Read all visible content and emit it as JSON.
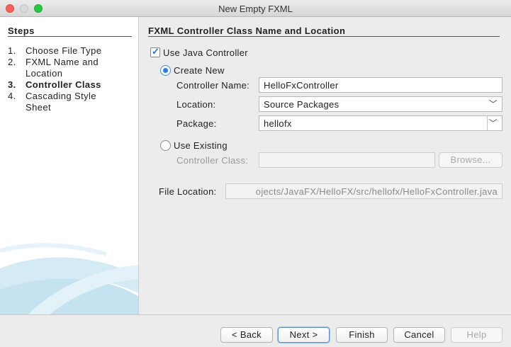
{
  "window": {
    "title": "New Empty FXML"
  },
  "steps": {
    "title": "Steps",
    "items": [
      {
        "num": "1.",
        "label": "Choose File Type"
      },
      {
        "num": "2.",
        "label": "FXML Name and Location"
      },
      {
        "num": "3.",
        "label": "Controller Class"
      },
      {
        "num": "4.",
        "label": "Cascading Style Sheet"
      }
    ],
    "active_index": 2
  },
  "panel": {
    "title": "FXML Controller Class Name and Location",
    "use_java_controller": {
      "label": "Use Java Controller",
      "checked": true
    },
    "create_new": {
      "label": "Create New",
      "selected": true
    },
    "controller_name": {
      "label": "Controller Name:",
      "value": "HelloFxController"
    },
    "location": {
      "label": "Location:",
      "value": "Source Packages"
    },
    "package": {
      "label": "Package:",
      "value": "hellofx"
    },
    "use_existing": {
      "label": "Use Existing",
      "selected": false
    },
    "controller_class": {
      "label": "Controller Class:",
      "value": ""
    },
    "browse_label": "Browse...",
    "file_location": {
      "label": "File Location:",
      "value": "ojects/JavaFX/HelloFX/src/hellofx/HelloFxController.java"
    }
  },
  "footer": {
    "back_label": "< Back",
    "next_label": "Next >",
    "finish_label": "Finish",
    "cancel_label": "Cancel",
    "help_label": "Help"
  },
  "colors": {
    "accent": "#2e7be3",
    "swoosh": "#bfe0ee"
  }
}
